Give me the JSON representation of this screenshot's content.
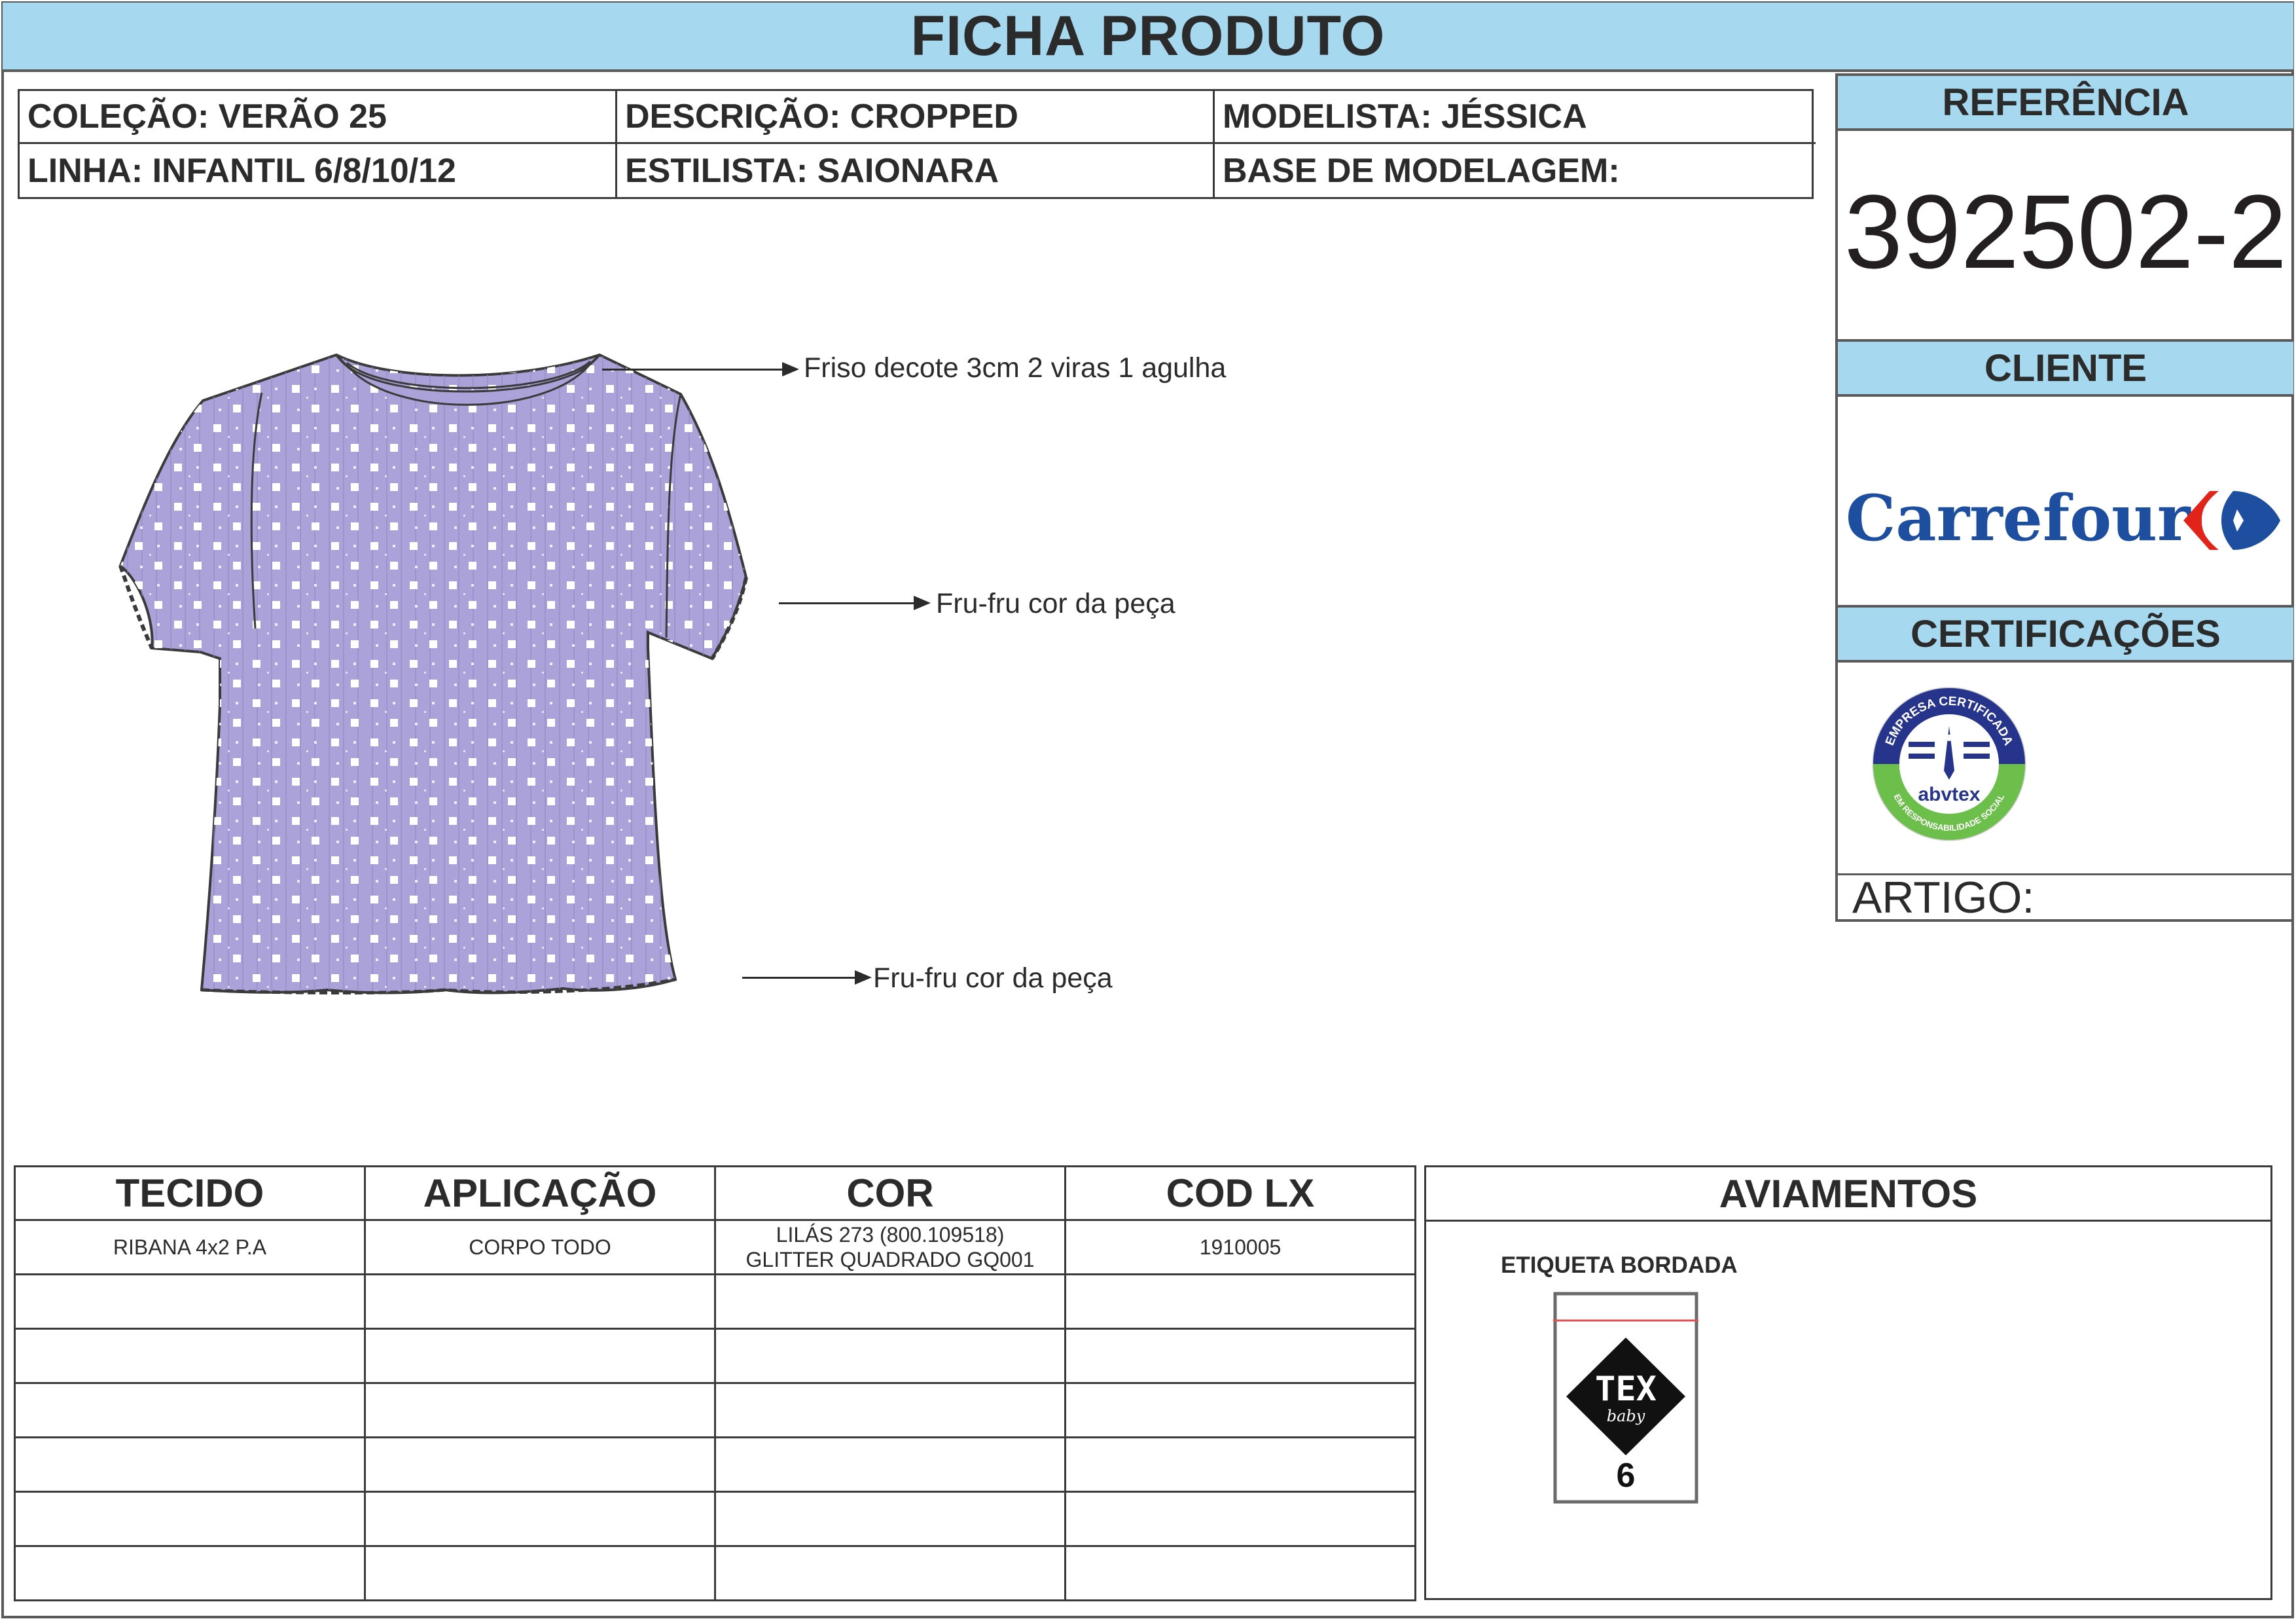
{
  "header": {
    "title": "FICHA PRODUTO"
  },
  "info": {
    "colecao": "COLEÇÃO: VERÃO 25",
    "descricao": "DESCRIÇÃO: CROPPED",
    "modelista": "MODELISTA: JÉSSICA",
    "linha": "LINHA: INFANTIL 6/8/10/12",
    "estilista": "ESTILISTA: SAIONARA",
    "base": "BASE DE MODELAGEM:"
  },
  "sidebar": {
    "referencia_label": "REFERÊNCIA",
    "referencia_value": "392502-2",
    "cliente_label": "CLIENTE",
    "cliente_logo_text": "Carrefour",
    "certificacoes_label": "CERTIFICAÇÕES",
    "cert_badge_text_top": "EMPRESA CERTIFICADA",
    "cert_badge_text_bottom": "EM RESPONSABILIDADE SOCIAL",
    "cert_badge_brand": "abvtex",
    "artigo_label": "ARTIGO:"
  },
  "drawing": {
    "garment_color": "#aba2d9",
    "annotations": [
      "Friso decote 3cm 2 viras 1 agulha",
      "Fru-fru cor da peça",
      "Fru-fru cor da peça"
    ]
  },
  "materials": {
    "headers": [
      "TECIDO",
      "APLICAÇÃO",
      "COR",
      "COD LX"
    ],
    "rows": [
      [
        "RIBANA 4x2 P.A",
        "CORPO TODO",
        "LILÁS 273 (800.109518) GLITTER QUADRADO GQ001",
        "1910005"
      ]
    ]
  },
  "aviamentos": {
    "title": "AVIAMENTOS",
    "item_title": "ETIQUETA BORDADA",
    "label_brand": "TEX",
    "label_sub": "baby",
    "label_size": "6"
  },
  "colors": {
    "header_blue": "#a6d8ef",
    "carrefour_blue": "#1d4ea0",
    "carrefour_red": "#e2231a"
  }
}
